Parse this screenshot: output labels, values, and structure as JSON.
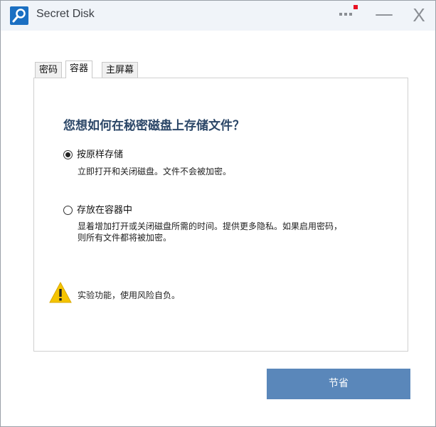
{
  "window": {
    "title": "Secret Disk",
    "minimize_glyph": "—",
    "close_glyph": "X"
  },
  "tabs": [
    {
      "label": "密码",
      "active": false
    },
    {
      "label": "容器",
      "active": true
    },
    {
      "label": "主屏幕",
      "active": false
    }
  ],
  "content": {
    "heading": "您想如何在秘密磁盘上存储文件？",
    "options": [
      {
        "label": "按原样存储",
        "checked": true,
        "description": [
          "立即打开和关闭磁盘。文件不会被加密。"
        ]
      },
      {
        "label": "存放在容器中",
        "checked": false,
        "description": [
          "显着增加打开或关闭磁盘所需的时间。提供更多隐私。如果启用密码，",
          "则所有文件都将被加密。"
        ]
      }
    ],
    "warning": "实验功能，使用风险自负。"
  },
  "footer": {
    "save_label": "节省"
  },
  "colors": {
    "accent": "#5a87ba",
    "app_icon": "#1b6fc2",
    "heading": "#2c4768",
    "notification_dot": "#e81123",
    "warning": "#f5c400"
  },
  "icons": {
    "app": "magnifier-key-icon",
    "menu": "dots-icon",
    "warning": "warning-icon"
  }
}
